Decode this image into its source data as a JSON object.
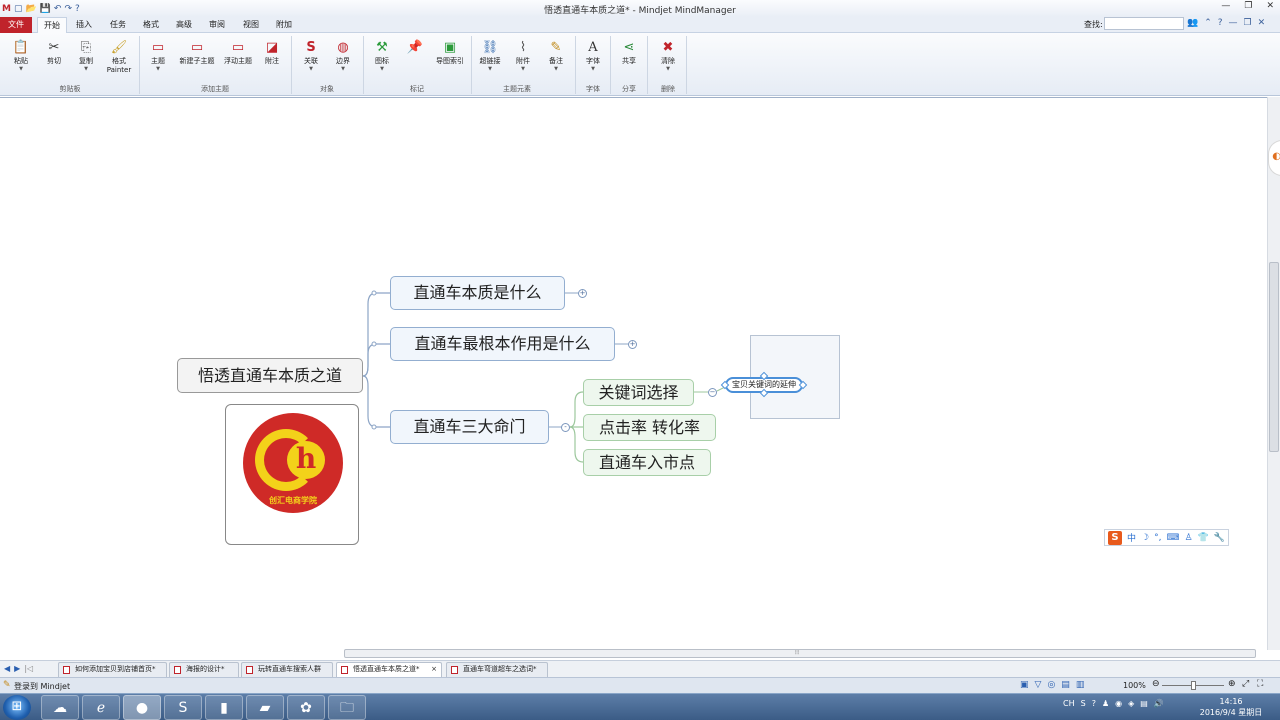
{
  "window": {
    "title": "悟透直通车本质之道* - Mindjet MindManager"
  },
  "ribbon_tabs": [
    {
      "label": "文件",
      "kind": "file"
    },
    {
      "label": "开始",
      "kind": "active"
    },
    {
      "label": "插入"
    },
    {
      "label": "任务"
    },
    {
      "label": "格式"
    },
    {
      "label": "高级"
    },
    {
      "label": "审阅"
    },
    {
      "label": "视图"
    },
    {
      "label": "附加"
    }
  ],
  "search": {
    "label": "查找:",
    "value": ""
  },
  "ribbon_groups": [
    {
      "label": "剪贴板"
    },
    {
      "label": "添加主题"
    },
    {
      "label": "对象"
    },
    {
      "label": "标记"
    },
    {
      "label": "主题元素"
    },
    {
      "label": "字体"
    },
    {
      "label": "分享"
    },
    {
      "label": "删除"
    }
  ],
  "ribbon_buttons": [
    {
      "label": "粘贴",
      "icon": "paste-icon",
      "glyph": "📋"
    },
    {
      "label": "剪切",
      "icon": "scissors-icon",
      "glyph": "✂"
    },
    {
      "label": "复制",
      "icon": "copy-icon",
      "glyph": "⎘"
    },
    {
      "label": "格式",
      "label2": "Painter",
      "icon": "format-painter-icon",
      "glyph": "🖌"
    },
    {
      "label": "主题",
      "icon": "topic-icon",
      "glyph": "▭"
    },
    {
      "label": "新建子主题",
      "icon": "subtopic-icon",
      "glyph": "▭"
    },
    {
      "label": "浮动主题",
      "icon": "floating-topic-icon",
      "glyph": "▭"
    },
    {
      "label": "附注",
      "icon": "callout-icon",
      "glyph": "◪"
    },
    {
      "label": "关联",
      "icon": "relationship-icon",
      "glyph": "S"
    },
    {
      "label": "边界",
      "icon": "boundary-icon",
      "glyph": "◍"
    },
    {
      "label": "图标",
      "icon": "marker-icon",
      "glyph": "⚒"
    },
    {
      "label": "",
      "icon": "pin-icon",
      "glyph": "📌"
    },
    {
      "label": "导图索引",
      "icon": "map-index-icon",
      "glyph": "▣"
    },
    {
      "label": "超链接",
      "icon": "hyperlink-icon",
      "glyph": "⛓"
    },
    {
      "label": "附件",
      "icon": "attachment-icon",
      "glyph": "⌇"
    },
    {
      "label": "备注",
      "icon": "notes-icon",
      "glyph": "✎"
    },
    {
      "label": "字体",
      "icon": "font-icon",
      "glyph": "A"
    },
    {
      "label": "共享",
      "icon": "share-icon",
      "glyph": "⋖"
    },
    {
      "label": "清除",
      "icon": "clear-icon",
      "glyph": "✖"
    }
  ],
  "map": {
    "central": "悟透直通车本质之道",
    "branches": [
      {
        "label": "直通车本质是什么",
        "expander": "+"
      },
      {
        "label": "直通车最根本作用是什么",
        "expander": "+"
      },
      {
        "label": "直通车三大命门",
        "expander": "-"
      }
    ],
    "subtopics": [
      {
        "label": "关键词选择"
      },
      {
        "label": "点击率 转化率"
      },
      {
        "label": "直通车入市点"
      }
    ],
    "floating_topic": "宝贝关键词的延伸",
    "logo_text": "创汇电商学院",
    "logo_letter": "h"
  },
  "ime_toolbar": {
    "logo": "S",
    "mode": "中",
    "items": [
      "☽",
      "°,",
      "⌨",
      "♙",
      "👕",
      "🔧"
    ]
  },
  "doc_tabs": [
    {
      "label": "如何添加宝贝到店铺首页*",
      "active": false
    },
    {
      "label": "海报的设计*",
      "active": false
    },
    {
      "label": "玩转直通车搜索人群",
      "active": false
    },
    {
      "label": "悟透直通车本质之道*",
      "active": true,
      "close": "×"
    },
    {
      "label": "直通车弯道超车之选词*",
      "active": false
    }
  ],
  "status": {
    "login": "登录到 Mindjet",
    "zoom": "100%"
  },
  "taskbar": {
    "apps": [
      "ie-icon",
      "record-icon",
      "sogou-browser-icon",
      "app-icon",
      "book-icon",
      "mail-icon",
      "folder-icon"
    ],
    "tray_lang": "CH",
    "time": "14:16",
    "date": "2016/9/4 星期日"
  }
}
